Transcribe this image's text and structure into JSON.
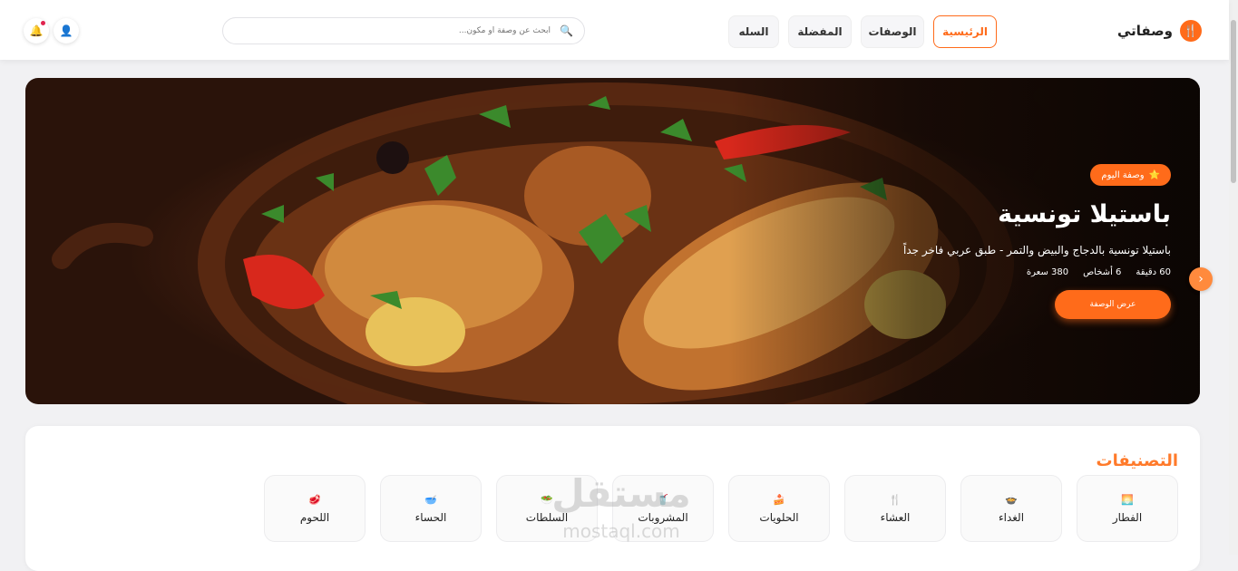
{
  "header": {
    "logo_text": "وصفاتي",
    "logo_icon": "utensils-icon",
    "nav": [
      {
        "label": "الرئيسية",
        "active": true
      },
      {
        "label": "الوصفات",
        "active": false
      },
      {
        "label": "المفضلة",
        "active": false
      },
      {
        "label": "السله",
        "active": false
      }
    ],
    "search_placeholder": "ابحث عن وصفة أو مكون...",
    "accent_color": "#ff6b1a"
  },
  "hero": {
    "badge": "وصفة اليوم",
    "title": "باستيلا تونسية",
    "description": "باستيلا تونسية بالدجاج والبيض والتمر - طبق عربي فاخر جداً",
    "time": "60 دقيقة",
    "servings": "6 أشخاص",
    "calories": "380 سعرة",
    "cta": "عرض الوصفة"
  },
  "categories": {
    "title": "التصنيفات",
    "items": [
      {
        "label": "الفطار",
        "icon": "sunrise-icon"
      },
      {
        "label": "الغداء",
        "icon": "bowl-icon"
      },
      {
        "label": "العشاء",
        "icon": "fork-knife-icon"
      },
      {
        "label": "الحلويات",
        "icon": "cake-icon"
      },
      {
        "label": "المشروبات",
        "icon": "cup-icon"
      },
      {
        "label": "السلطات",
        "icon": "salad-icon"
      },
      {
        "label": "الحساء",
        "icon": "soup-icon"
      },
      {
        "label": "اللحوم",
        "icon": "meat-icon"
      }
    ]
  },
  "watermark": {
    "ar": "مستقل",
    "en": "mostaql.com"
  }
}
